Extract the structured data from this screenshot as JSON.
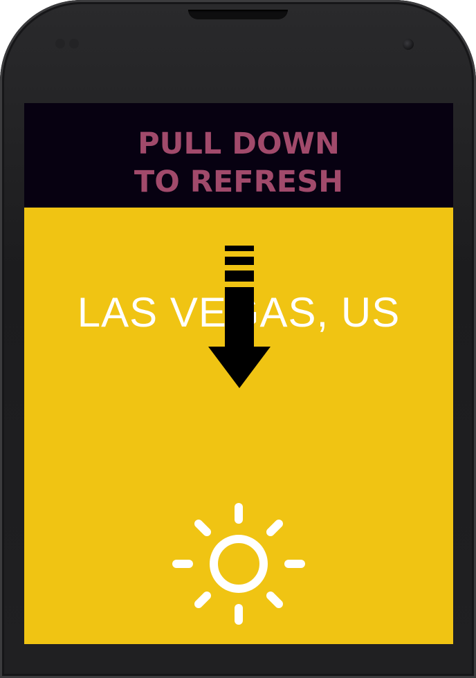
{
  "refresh_banner": {
    "line1": "PULL DOWN",
    "line2": "TO REFRESH"
  },
  "weather": {
    "location": "LAS VEGAS, US",
    "condition_icon": "sun-icon"
  },
  "gesture_hint": {
    "icon": "pull-down-arrow-icon"
  },
  "colors": {
    "background": "#f0c413",
    "banner_background": "#070111",
    "banner_text": "#a14a6b",
    "location_text": "#ffffff",
    "arrow": "#000000",
    "sun": "#ffffff"
  }
}
